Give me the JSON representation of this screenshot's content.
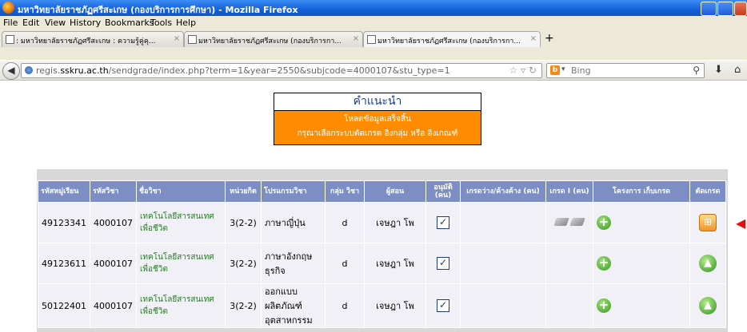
{
  "window": {
    "title": "มหาวิทยาลัยราชภัฏศรีสะเกษ (กองบริการการศึกษา) - Mozilla Firefox"
  },
  "menu": [
    "File",
    "Edit",
    "View",
    "History",
    "Bookmarks",
    "Tools",
    "Help"
  ],
  "tabs": [
    {
      "label": ": มหาวิทยาลัยราชภัฏศรีสะเกษ : ความรู้คู่คุ...",
      "active": false
    },
    {
      "label": "มหาวิทยาลัยราชภัฏศรีสะเกษ (กองบริการกา...",
      "active": false
    },
    {
      "label": "มหาวิทยาลัยราชภัฏศรีสะเกษ (กองบริการกา...",
      "active": true
    }
  ],
  "new_tab": "+",
  "nav": {
    "url_gray": "regis.",
    "url_domain": "sskru.ac.th",
    "url_rest": "/sendgrade/index.php?term=1&year=2550&subjcode=4000107&stu_type=1",
    "search_placeholder": "Bing"
  },
  "advice": {
    "title": "คำแนะนำ",
    "line1": "โหลดข้อมูลเสร็จสิ้น",
    "line2": "กรุณาเลือกระบบตัดเกรด อิงกลุ่ม หรือ อิงเกณฑ์"
  },
  "table": {
    "headers": [
      "รหัสหมู่เรียน",
      "รหัสวิชา",
      "ชื่อวิชา",
      "หน่วยกิต",
      "โปรแกรมวิชา",
      "กลุ่ม วิชา",
      "ผู้สอน",
      "อนุมัติ (คน)",
      "เกรดว่าง/ค้างค้าง (คน)",
      "เกรด I (คน)",
      "โครงการ เก็บเกรด",
      "ตัดเกรด"
    ],
    "rows": [
      {
        "section": "49123341",
        "code": "4000107",
        "name": "เทคโนโลยีสารสนเทศเพื่อชีวิต",
        "credit": "3(2-2)",
        "program": "ภาษาญี่ปุ่น",
        "group": "d",
        "teacher": "เจษฎา โพ",
        "status": "with-pens",
        "action": "calc"
      },
      {
        "section": "49123611",
        "code": "4000107",
        "name": "เทคโนโลยีสารสนเทศเพื่อชีวิต",
        "credit": "3(2-2)",
        "program": "ภาษาอังกฤษธุรกิจ",
        "group": "d",
        "teacher": "เจษฎา โพ",
        "status": "plain",
        "action": "up"
      },
      {
        "section": "50122401",
        "code": "4000107",
        "name": "เทคโนโลยีสารสนเทศเพื่อชีวิต",
        "credit": "3(2-2)",
        "program": "ออกแบบผลิตภัณฑ์อุตสาหกรรม",
        "group": "d",
        "teacher": "เจษฎา โพ",
        "status": "plain",
        "action": "up"
      }
    ]
  },
  "colors": {
    "header_bg": "#7c8ec4",
    "advice_bg": "#ff8c00",
    "subject_text": "#2a7a2a"
  }
}
